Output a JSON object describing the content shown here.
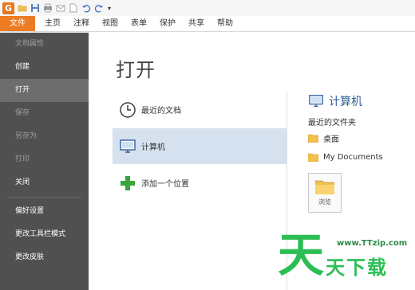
{
  "quick_access": {
    "app_icon": "foxit-logo",
    "buttons": [
      "open-icon",
      "save-icon",
      "print-icon",
      "email-icon",
      "new-icon",
      "undo-icon",
      "redo-icon",
      "customize-icon"
    ]
  },
  "tabs": [
    "文件",
    "主页",
    "注释",
    "视图",
    "表单",
    "保护",
    "共享",
    "帮助"
  ],
  "sidebar": {
    "items": [
      {
        "label": "文档属性",
        "state": "disabled"
      },
      {
        "label": "创建",
        "state": "normal"
      },
      {
        "label": "打开",
        "state": "active"
      },
      {
        "label": "保存",
        "state": "disabled"
      },
      {
        "label": "另存为",
        "state": "disabled"
      },
      {
        "label": "打印",
        "state": "disabled"
      },
      {
        "label": "关闭",
        "state": "normal"
      },
      {
        "label": "偏好设置",
        "state": "normal"
      },
      {
        "label": "更改工具栏模式",
        "state": "normal"
      },
      {
        "label": "更改皮肤",
        "state": "normal"
      }
    ]
  },
  "main": {
    "title": "打开",
    "places": [
      {
        "label": "最近的文档",
        "icon": "clock-icon",
        "selected": false
      },
      {
        "label": "计算机",
        "icon": "computer-icon",
        "selected": true
      },
      {
        "label": "添加一个位置",
        "icon": "plus-icon",
        "selected": false
      }
    ],
    "detail": {
      "title": "计算机",
      "recent_folders_label": "最近的文件夹",
      "folders": [
        "桌面",
        "My Documents"
      ],
      "browse_label": "浏览"
    }
  },
  "watermark": {
    "big_char": "天",
    "url": "www.TTzip.com",
    "text": "天下载"
  },
  "colors": {
    "accent": "#ec7c24",
    "sidebar_bg": "#505050",
    "sidebar_active": "#6d6d6d",
    "selected_place": "#d5e1ef",
    "detail_title": "#2e5f99",
    "watermark_green": "#2cbe54"
  }
}
